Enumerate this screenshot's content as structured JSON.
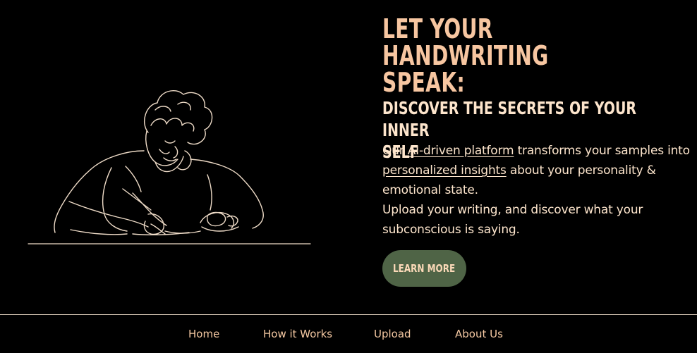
{
  "hero": {
    "headline_line1": "LET YOUR HANDWRITING",
    "headline_line2": "SPEAK:",
    "subhead_line1": "DISCOVER THE SECRETS OF YOUR INNER",
    "subhead_line2": "SELF",
    "body": {
      "p1_before": "Our ",
      "p1_link1": "AI-driven platform",
      "p1_mid": " transforms your samples into ",
      "p1_link2": "personalized insights",
      "p1_after": " about your personality & emotional state.",
      "p2": "Upload your writing, and discover what your subconscious is saying."
    },
    "cta_label": "LEARN MORE",
    "cta_color": "#4f6446"
  },
  "footer": {
    "nav": [
      "Home",
      "How it Works",
      "Upload",
      "About Us"
    ]
  },
  "colors": {
    "background": "#000000",
    "headline": "#f7c6a1",
    "text": "#fde5cc",
    "nav": "#f4c8a2"
  }
}
